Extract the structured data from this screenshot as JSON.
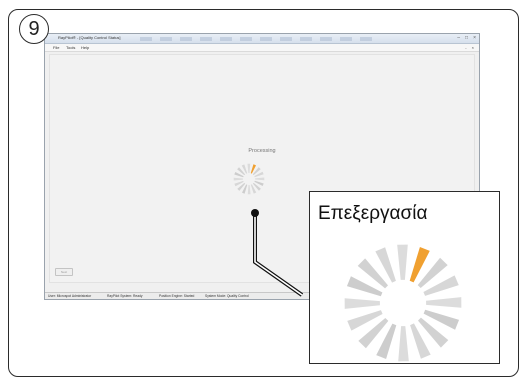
{
  "step": {
    "number": "9"
  },
  "window": {
    "title": "RayPilot® - [Quality Control Status]",
    "controls": [
      "–",
      "□",
      "×"
    ],
    "mdi_controls": "- ×"
  },
  "menu": {
    "items": [
      "File",
      "Tools",
      "Help"
    ]
  },
  "main": {
    "processing_label": "Processing",
    "next_button": "Next"
  },
  "status": {
    "user": "User: Microspot Administrator",
    "system": "RayPilot System: Ready",
    "engine": "Position Engine: Started",
    "mode": "System Mode: Quality Control"
  },
  "callout": {
    "label": "Επεξεργασία"
  },
  "colors": {
    "accent": "#f0a030",
    "spinner_segment": "#d4d4d4",
    "frame_border": "#2b2b2b"
  }
}
